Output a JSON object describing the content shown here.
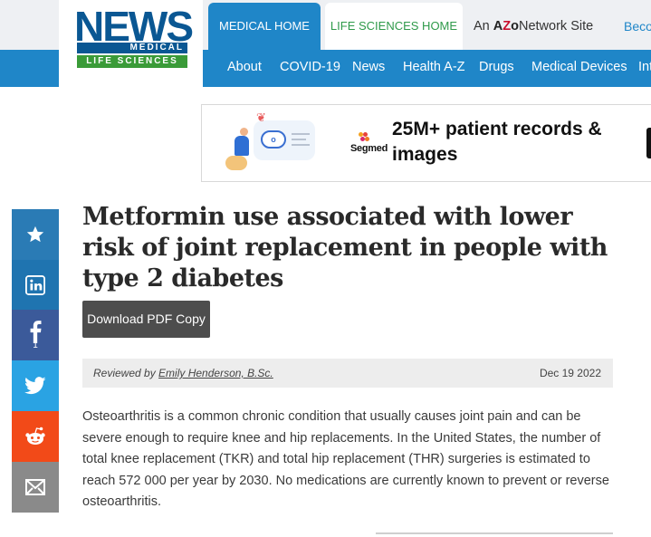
{
  "logo": {
    "line1": "NEWS",
    "line2": "MEDICAL",
    "line3": "LIFE SCIENCES"
  },
  "tabs": [
    {
      "label": "MEDICAL HOME"
    },
    {
      "label": "LIFE SCIENCES HOME"
    }
  ],
  "network": {
    "prefix": "An",
    "brand_a": "A",
    "brand_z": "Z",
    "brand_o": "o",
    "suffix": "Network Site",
    "become": "Becom"
  },
  "nav": [
    "About",
    "COVID-19",
    "News",
    "Health A-Z",
    "Drugs",
    "Medical Devices",
    "Int"
  ],
  "ad": {
    "brand": "Segmed",
    "headline": "25M+ patient records & images",
    "pill_icon": "o"
  },
  "share": {
    "facebook_count": "1"
  },
  "article": {
    "title": "Metformin use associated with lower risk of joint replacement in people with type 2 diabetes",
    "download_label": "Download PDF Copy",
    "reviewed_prefix": "Reviewed by",
    "reviewer": "Emily Henderson, B.Sc.",
    "date": "Dec 19 2022",
    "body": "Osteoarthritis is a common chronic condition that usually causes joint pain and can be severe enough to require knee and hip replacements. In the United States, the number of total knee replacement (TKR) and total hip replacement (THR) surgeries is estimated to reach 572 000 per year by 2030. No medications are currently known to prevent or reverse osteoarthritis."
  },
  "colors": {
    "brand_blue": "#1f86c8",
    "brand_green": "#3a9b38",
    "dark_blue": "#0a5793"
  }
}
